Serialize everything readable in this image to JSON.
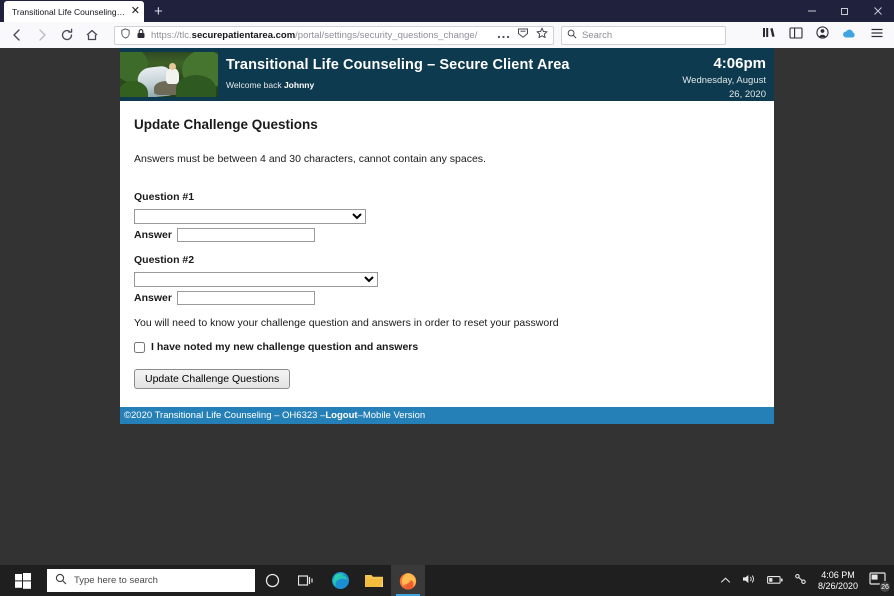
{
  "browser": {
    "tab": {
      "title": "Transitional Life Counseling - Secu",
      "close_icon": "close-icon"
    },
    "new_tab_label": "+",
    "window_controls": {
      "minimize": "minimize",
      "restore": "restore",
      "close": "close"
    },
    "nav": {
      "back": "back-arrow-icon",
      "forward": "forward-arrow-icon",
      "reload": "reload-icon",
      "home": "home-icon"
    },
    "url": {
      "scheme": "https://tlc.",
      "domain": "securepatientarea.com",
      "path": "/portal/settings/security_questions_change/"
    },
    "url_icons": {
      "tracking": "shield-icon",
      "lock": "padlock-icon",
      "more": "ellipsis-icon",
      "reader": "reader-view-icon",
      "bookmark": "star-icon"
    },
    "search": {
      "placeholder": "Search",
      "icon": "magnifier-icon"
    },
    "toolbar_icons": [
      "library-icon",
      "sidebar-icon",
      "account-icon",
      "sync-cloud-icon",
      "hamburger-menu-icon"
    ],
    "accent": "#20223d"
  },
  "site": {
    "title": "Transitional Life Counseling – Secure Client Area",
    "welcome_prefix": "Welcome back ",
    "welcome_user": "Johnny",
    "time": "4:06pm",
    "date_line1": "Wednesday, August",
    "date_line2": "26, 2020",
    "header_color": "#0e3a4f",
    "banner_alt": "waterfall-nature-photo"
  },
  "main": {
    "heading": "Update Challenge Questions",
    "note": "Answers must be between 4 and 30 characters, cannot contain any spaces.",
    "question1_label": "Question #1",
    "question1_value": "",
    "answer1_label": "Answer",
    "answer1_value": "",
    "question2_label": "Question #2",
    "question2_value": "",
    "answer2_label": "Answer",
    "answer2_value": "",
    "reset_note": "You will need to know your challenge question and answers in order to reset your password",
    "checkbox_label": "I have noted my new challenge question and answers",
    "checkbox_checked": false,
    "submit_label": "Update Challenge Questions"
  },
  "footer": {
    "copyright": "©2020 Transitional Life Counseling – OH6323 – ",
    "logout": "Logout",
    "separator": " – ",
    "mobile": "Mobile Version",
    "color": "#2680b8"
  },
  "taskbar": {
    "start_icon": "windows-start-icon",
    "search_placeholder": "Type here to search",
    "search_icon": "magnifier-icon",
    "items": [
      "cortana-icon",
      "task-view-icon",
      "edge-browser-icon",
      "file-explorer-icon",
      "firefox-browser-icon"
    ],
    "tray_icons": [
      "show-hidden-icons-chevron",
      "volume-icon",
      "battery-icon",
      "network-icon"
    ],
    "clock_time": "4:06 PM",
    "clock_date": "8/26/2020",
    "notification_count": "26"
  }
}
